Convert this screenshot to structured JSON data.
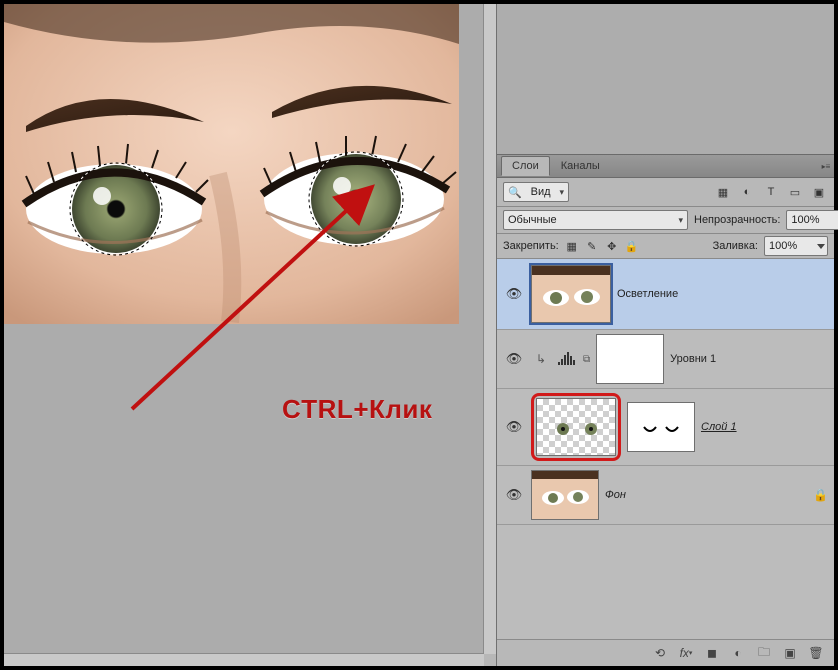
{
  "annotation": {
    "label": "CTRL+Клик"
  },
  "panel": {
    "tabs": {
      "layers": "Слои",
      "channels": "Каналы"
    },
    "search": {
      "kind_label": "Вид"
    },
    "blend": {
      "mode": "Обычные",
      "opacity_label": "Непрозрачность:",
      "opacity_value": "100%"
    },
    "lock": {
      "label": "Закрепить:",
      "fill_label": "Заливка:",
      "fill_value": "100%"
    },
    "layers": [
      {
        "name": "Осветление"
      },
      {
        "name": "Уровни 1"
      },
      {
        "name": "Слой 1"
      },
      {
        "name": "Фон"
      }
    ]
  }
}
